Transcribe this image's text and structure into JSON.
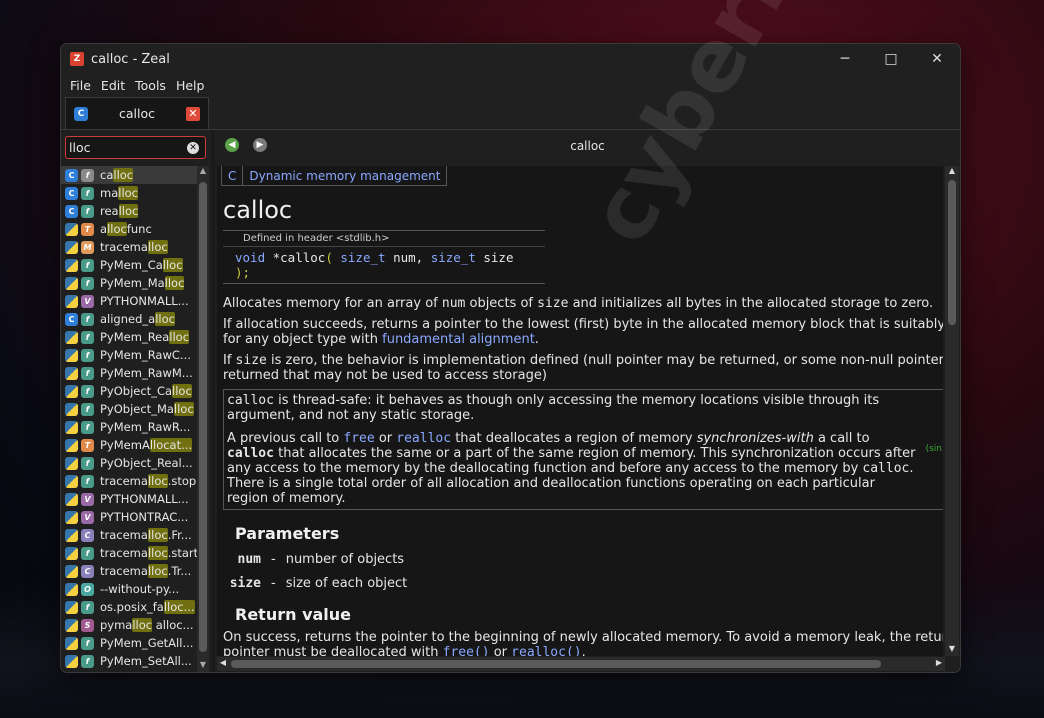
{
  "window": {
    "title": "calloc - Zeal",
    "app_icon": "zeal-icon",
    "controls": [
      "minimize",
      "maximize",
      "close"
    ]
  },
  "menu": [
    "File",
    "Edit",
    "Tools",
    "Help"
  ],
  "tab": {
    "label": "calloc",
    "icon": "c-docset-icon"
  },
  "search": {
    "value": "lloc"
  },
  "results": [
    {
      "kind": "fg",
      "lang": "c",
      "pre": "ca",
      "hl": "lloc",
      "post": "",
      "selected": true
    },
    {
      "kind": "f",
      "lang": "c",
      "pre": "ma",
      "hl": "lloc",
      "post": ""
    },
    {
      "kind": "f",
      "lang": "c",
      "pre": "rea",
      "hl": "lloc",
      "post": ""
    },
    {
      "kind": "t",
      "lang": "py",
      "pre": "a",
      "hl": "lloc",
      "post": "func"
    },
    {
      "kind": "m",
      "lang": "py",
      "pre": "tracema",
      "hl": "lloc",
      "post": ""
    },
    {
      "kind": "f",
      "lang": "py",
      "pre": "PyMem_Ca",
      "hl": "lloc",
      "post": ""
    },
    {
      "kind": "f",
      "lang": "py",
      "pre": "PyMem_Ma",
      "hl": "lloc",
      "post": ""
    },
    {
      "kind": "v",
      "lang": "py",
      "pre": "PYTHONMALL...",
      "hl": "",
      "post": ""
    },
    {
      "kind": "f",
      "lang": "c",
      "pre": "aligned_a",
      "hl": "lloc",
      "post": ""
    },
    {
      "kind": "f",
      "lang": "py",
      "pre": "PyMem_Rea",
      "hl": "lloc",
      "post": ""
    },
    {
      "kind": "f",
      "lang": "py",
      "pre": "PyMem_RawC...",
      "hl": "",
      "post": ""
    },
    {
      "kind": "f",
      "lang": "py",
      "pre": "PyMem_RawM...",
      "hl": "",
      "post": ""
    },
    {
      "kind": "f",
      "lang": "py",
      "pre": "PyObject_Ca",
      "hl": "lloc",
      "post": ""
    },
    {
      "kind": "f",
      "lang": "py",
      "pre": "PyObject_Ma",
      "hl": "lloc",
      "post": ""
    },
    {
      "kind": "f",
      "lang": "py",
      "pre": "PyMem_RawR...",
      "hl": "",
      "post": ""
    },
    {
      "kind": "t",
      "lang": "py",
      "pre": "PyMemA",
      "hl": "llocat...",
      "post": ""
    },
    {
      "kind": "f",
      "lang": "py",
      "pre": "PyObject_Real...",
      "hl": "",
      "post": ""
    },
    {
      "kind": "f",
      "lang": "py",
      "pre": "tracema",
      "hl": "lloc",
      "post": ".stop"
    },
    {
      "kind": "v",
      "lang": "py",
      "pre": "PYTHONMALL...",
      "hl": "",
      "post": ""
    },
    {
      "kind": "v",
      "lang": "py",
      "pre": "PYTHONTRAC...",
      "hl": "",
      "post": ""
    },
    {
      "kind": "cc",
      "lang": "py",
      "pre": "tracema",
      "hl": "lloc",
      "post": ".Fr..."
    },
    {
      "kind": "f",
      "lang": "py",
      "pre": "tracema",
      "hl": "lloc",
      "post": ".start"
    },
    {
      "kind": "cc",
      "lang": "py",
      "pre": "tracema",
      "hl": "lloc",
      "post": ".Tr..."
    },
    {
      "kind": "o",
      "lang": "py",
      "pre": "--without-py...",
      "hl": "",
      "post": ""
    },
    {
      "kind": "f",
      "lang": "py",
      "pre": "os.posix_fa",
      "hl": "lloc...",
      "post": ""
    },
    {
      "kind": "s",
      "lang": "py",
      "pre": "pyma",
      "hl": "lloc",
      "post": " alloc..."
    },
    {
      "kind": "f",
      "lang": "py",
      "pre": "PyMem_GetAll...",
      "hl": "",
      "post": ""
    },
    {
      "kind": "f",
      "lang": "py",
      "pre": "PyMem_SetAll...",
      "hl": "",
      "post": ""
    }
  ],
  "nav": {
    "title": "calloc"
  },
  "doc": {
    "breadcrumb_lang": "C",
    "breadcrumb_section": "Dynamic memory management",
    "title": "calloc",
    "defined_in": "Defined in header <stdlib.h>",
    "sig_void": "void",
    "sig_name": " *calloc",
    "sig_open": "(",
    "sig_t1": " size_t",
    "sig_p1": " num, ",
    "sig_t2": "size_t",
    "sig_p2": " size ",
    "sig_close": ");",
    "p1_a": "Allocates memory for an array of ",
    "p1_num": "num",
    "p1_b": " objects of ",
    "p1_size": "size",
    "p1_c": " and initializes all bytes in the allocated storage to zero.",
    "p2_a": "If allocation succeeds, returns a pointer to the lowest (first) byte in the allocated memory block that is suitably a",
    "p2_b": "for any object type with ",
    "p2_link": "fundamental alignment",
    "p2_c": ".",
    "p3_a": "If ",
    "p3_size": "size",
    "p3_b": " is zero, the behavior is implementation defined (null pointer may be returned, or some non-null pointer m",
    "p3_c": "returned that may not be used to access storage)",
    "note1_code": "calloc",
    "note1_text": " is thread-safe: it behaves as though only accessing the memory locations visible through its argument, and not any static storage.",
    "note2_a": "A previous call to ",
    "note2_free": "free",
    "note2_or": " or ",
    "note2_realloc": "realloc",
    "note2_b": " that deallocates a region of memory ",
    "note2_sync": "synchronizes-with",
    "note2_c": " a call to ",
    "note2_calloc": "calloc",
    "note2_d": " that allocates the same or a part of the same region of memory. This synchronization occurs after any access to the memory by the deallocating function and before any access to the memory by ",
    "note2_calloc2": "calloc",
    "note2_e": ". There is a single total order of all allocation and deallocation functions operating on each particular region of memory.",
    "since": "(sin",
    "params_heading": "Parameters",
    "params": [
      {
        "name": "num",
        "dash": "-",
        "desc": "number of objects"
      },
      {
        "name": "size",
        "dash": "-",
        "desc": "size of each object"
      }
    ],
    "return_heading": "Return value",
    "ret_a": "On success, returns the pointer to the beginning of newly allocated memory. To avoid a memory leak, the return",
    "ret_b": "pointer must be deallocated with ",
    "ret_free": "free()",
    "ret_or": " or ",
    "ret_realloc": "realloc()",
    "ret_c": "."
  },
  "watermark": "cyberly.net"
}
